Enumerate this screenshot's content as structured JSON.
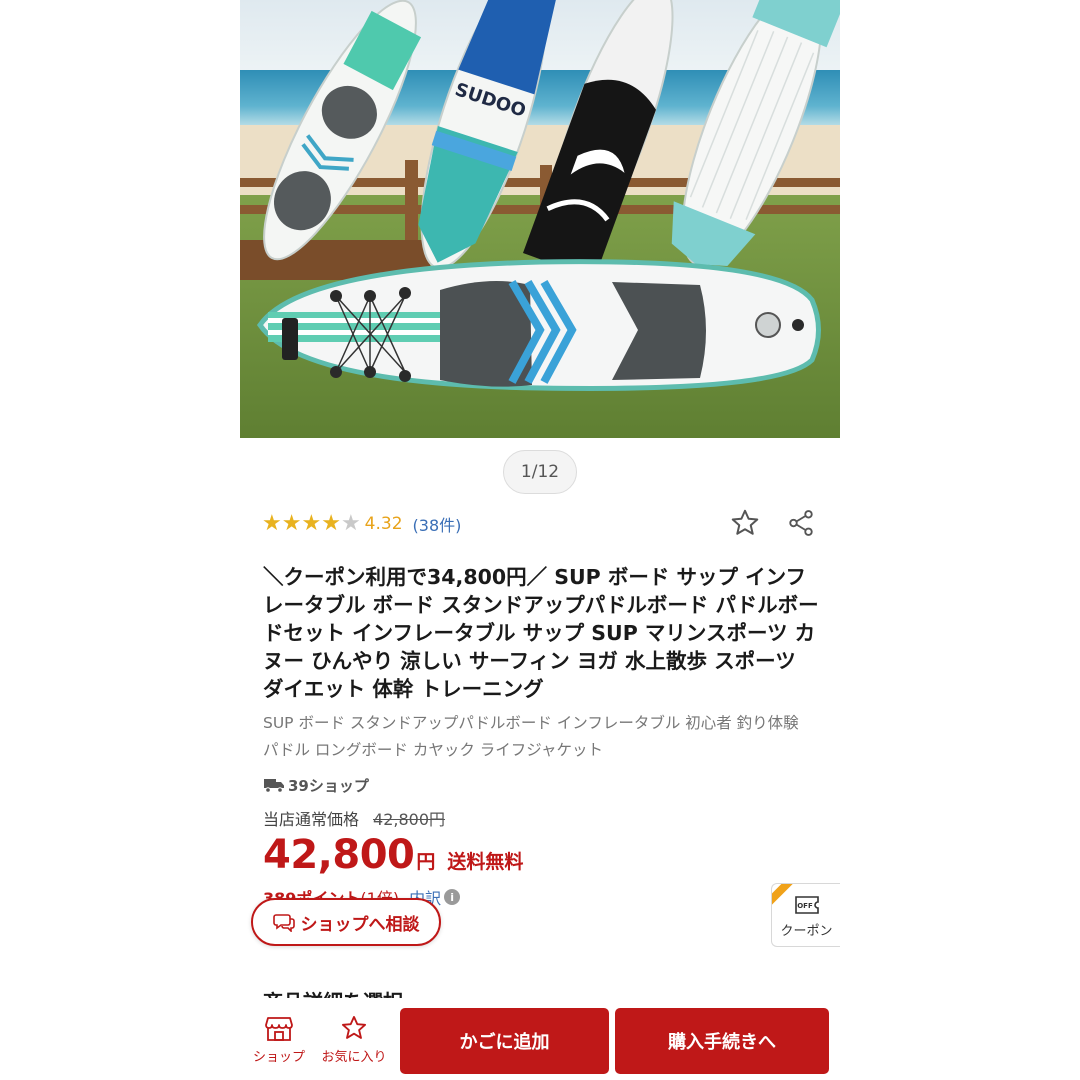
{
  "gallery": {
    "pager": "1/12",
    "board_brand": "SUDOO"
  },
  "rating": {
    "stars_filled": 4,
    "stars_total": 5,
    "value": "4.32",
    "count": "(38件)"
  },
  "actions": {
    "favorite_icon": "star-outline-icon",
    "share_icon": "share-icon"
  },
  "product": {
    "title": "＼クーポン利用で34,800円／ SUP ボード サップ インフレータブル ボード スタンドアップパドルボード パドルボードセット インフレータブル サップ SUP マリンスポーツ カヌー ひんやり 涼しい サーフィン ヨガ 水上散歩 スポーツ ダイエット 体幹 トレーニング",
    "subtitle": "SUP ボード スタンドアップパドルボード インフレータブル 初心者 釣り体験 パドル ロングボード カヤック ライフジャケット"
  },
  "shop": {
    "badge": "39ショップ"
  },
  "pricing": {
    "normal_label": "当店通常価格",
    "normal_price": "42,800円",
    "price": "42,800",
    "price_unit": "円",
    "shipping": "送料無料",
    "points": "389ポイント",
    "points_rate": "(1倍)",
    "tax": "内訳",
    "info_icon": "i"
  },
  "consult": {
    "label": "ショップへ相談"
  },
  "coupon": {
    "icon_text": "OFF",
    "label": "クーポン"
  },
  "sections": {
    "detail_heading": "商品詳細を選択"
  },
  "bottom_bar": {
    "shop_label": "ショップ",
    "fav_label": "お気に入り",
    "cart_label": "かごに追加",
    "buy_label": "購入手続きへ"
  },
  "colors": {
    "accent": "#bf1818",
    "star": "#e8b21f",
    "link": "#3b6fb6"
  }
}
